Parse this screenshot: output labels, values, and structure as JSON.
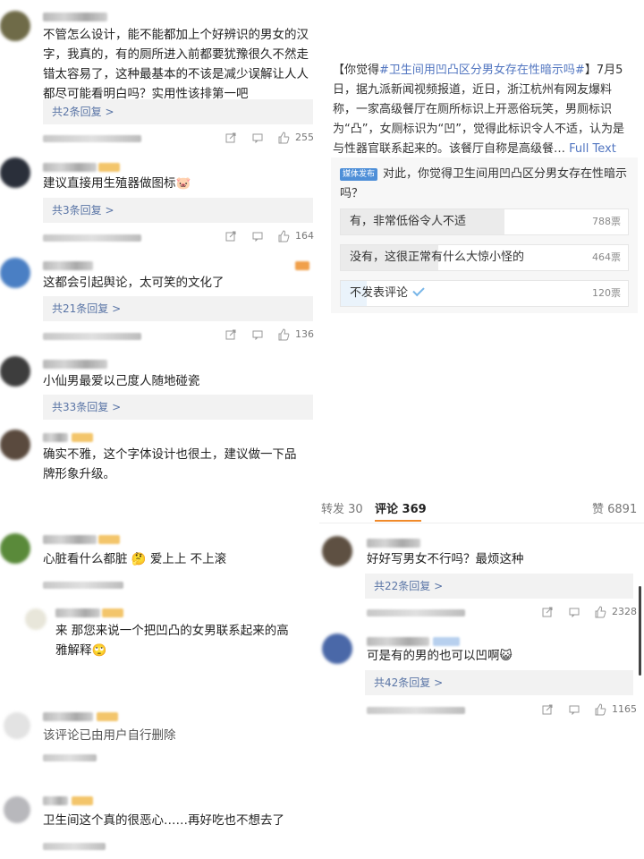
{
  "left_comments": [
    {
      "text_lines": [
        "不管怎么设计，能不能都加上个好辨识的男女的汉",
        "字，我真的，有的厕所进入前都要犹豫很久不然走",
        "错太容易了，这种最基本的不该是减少误解让人人",
        "都尽可能看明白吗？实用性该排第一吧"
      ],
      "replies": "共2条回复 >",
      "likes": "255"
    },
    {
      "text_lines": [
        "建议直接用生殖器做图标🐷"
      ],
      "replies": "共3条回复 >",
      "likes": "164"
    },
    {
      "text_lines": [
        "这都会引起舆论，太可笑的文化了"
      ],
      "replies": "共21条回复 >",
      "likes": "136"
    },
    {
      "text_lines": [
        "小仙男最爱以己度人随地碰瓷"
      ],
      "replies": "共33条回复 >",
      "likes": ""
    },
    {
      "text_lines": [
        "确实不雅，这个字体设计也很土，建议做一下品",
        "牌形象升级。"
      ],
      "replies": "",
      "likes": ""
    },
    {
      "text_lines": [
        "心脏看什么都脏 🤔 爱上上 不上滚"
      ],
      "replies": "",
      "likes": ""
    },
    {
      "text_lines": [
        "来 那您来说一个把凹凸的女男联系起来的高",
        "雅解释🙄"
      ],
      "replies": "",
      "likes": ""
    },
    {
      "text_lines": [
        "该评论已由用户自行删除"
      ],
      "replies": "",
      "likes": ""
    },
    {
      "text_lines": [
        "卫生间这个真的很恶心……再好吃也不想去了"
      ],
      "replies": "",
      "likes": ""
    }
  ],
  "article": {
    "prefix": "【你觉得",
    "hashtag": "#卫生间用凹凸区分男女存在性暗示吗#",
    "body": "】7月5日，据九派新闻视频报道，近日，浙江杭州有网友爆料称，一家高级餐厅在厕所标识上开恶俗玩笑，男厕标识为“凸”，女厕标识为“凹”，觉得此标识令人不适，认为是与性器官联系起来的。该餐厅自称是高级餐…",
    "full_text": "Full Text"
  },
  "poll": {
    "tag": "媒体发布",
    "question": "对此，你觉得卫生间用凹凸区分男女存在性暗示吗？",
    "options": [
      {
        "label": "有，非常低俗令人不适",
        "count": "788票",
        "fraction": 0.57,
        "selected": false
      },
      {
        "label": "没有，这很正常有什么大惊小怪的",
        "count": "464票",
        "fraction": 0.34,
        "selected": false
      },
      {
        "label": "不发表评论",
        "count": "120票",
        "fraction": 0.09,
        "selected": true
      }
    ]
  },
  "tabs": {
    "repost": "转发 30",
    "comments": "评论 369",
    "likes": "赞 6891"
  },
  "right_comments": [
    {
      "text": "好好写男女不行吗？最烦这种",
      "replies": "共22条回复 >",
      "likes": "2328"
    },
    {
      "text": "可是有的男的也可以凹啊😺",
      "replies": "共42条回复 >",
      "likes": "1165"
    }
  ],
  "colors": {
    "link": "#5a75a6",
    "hashtag": "#5175c0",
    "tab_accent": "#f08a2a",
    "poll_tag": "#4e8fd8"
  }
}
